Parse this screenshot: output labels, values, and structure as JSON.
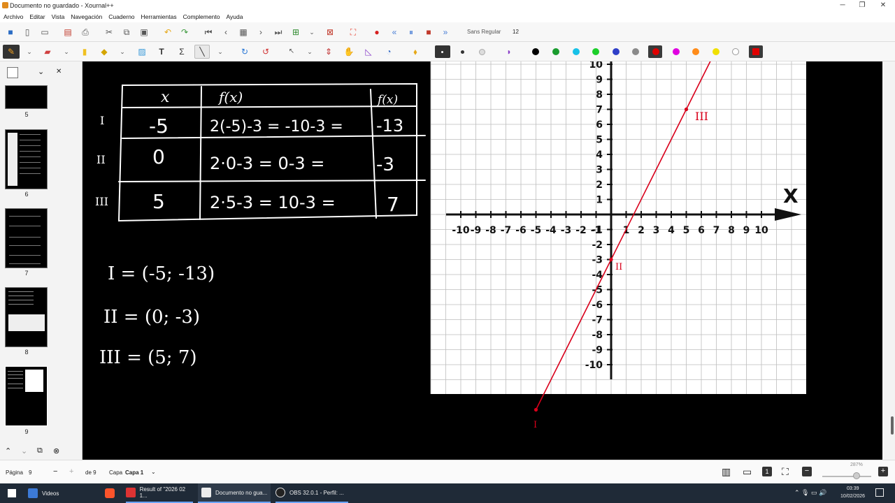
{
  "window": {
    "title": "Documento no guardado - Xournal++",
    "minimize": "─",
    "maximize": "❐",
    "close": "✕"
  },
  "menu": [
    "Archivo",
    "Editar",
    "Vista",
    "Navegación",
    "Cuaderno",
    "Herramientas",
    "Complemento",
    "Ayuda"
  ],
  "toolbar": {
    "font_name": "Sans Regular",
    "font_size": "12"
  },
  "palette": [
    "#000000",
    "#1a9c2f",
    "#17c1e8",
    "#1ccf2a",
    "#2f3fc8",
    "#8a8a8a",
    "#e00000",
    "#e000e0",
    "#ff8c1a",
    "#f0e000",
    "#ffffff",
    "#e00000"
  ],
  "sidebar": {
    "pages": [
      "5",
      "6",
      "7",
      "8",
      "9"
    ]
  },
  "notes": {
    "table_headers": [
      "x",
      "f(x)",
      "f(x)"
    ],
    "row_markers": [
      "I",
      "II",
      "III"
    ],
    "rows": [
      {
        "x": "-5",
        "calc": "2(-5)-3 = -10-3 =",
        "fx": "-13"
      },
      {
        "x": "0",
        "calc": "2·0-3 = 0-3 =",
        "fx": "-3"
      },
      {
        "x": "5",
        "calc": "2·5-3 = 10-3 =",
        "fx": "7"
      }
    ],
    "points": [
      "I = (-5; -13)",
      "II = (0; -3)",
      "III = (5; 7)"
    ],
    "point_labels": [
      "II",
      "III",
      "I"
    ]
  },
  "graph": {
    "axis_x_label": "X",
    "x_ticks": [
      "-10",
      "-9",
      "-8",
      "-7",
      "-6",
      "-5",
      "-4",
      "-3",
      "-2",
      "-1",
      "1",
      "2",
      "3",
      "4",
      "5",
      "6",
      "7",
      "8",
      "9",
      "10"
    ],
    "y_ticks": [
      "10",
      "9",
      "8",
      "7",
      "6",
      "5",
      "4",
      "3",
      "2",
      "1",
      "-1",
      "-2",
      "-3",
      "-4",
      "-5",
      "-6",
      "-7",
      "-8",
      "-9",
      "-10"
    ],
    "line_color": "#d9001b"
  },
  "status": {
    "page_label": "Página",
    "page_value": "9",
    "of_label": "de 9",
    "layer_label": "Capa",
    "layer_value": "Capa 1",
    "zoom": "287%"
  },
  "taskbar": {
    "items": [
      "Videos",
      "Result of \"2026 02 1...",
      "Documento no gua...",
      "OBS 32.0.1 - Perfil: ..."
    ],
    "time": "03:39",
    "date": "10/02/2026"
  }
}
